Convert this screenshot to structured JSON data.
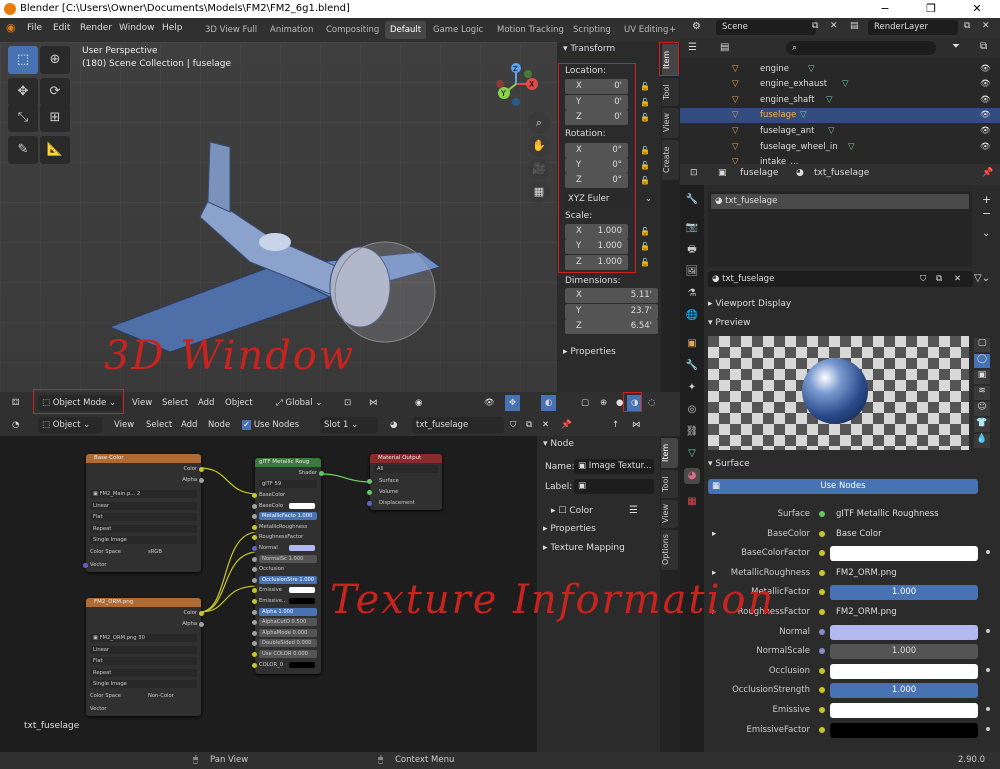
{
  "window": {
    "title": "Blender [C:\\Users\\Owner\\Documents\\Models\\FM2\\FM2_6g1.blend]",
    "minimize": "−",
    "maximize": "❐",
    "close": "✕"
  },
  "menu": [
    "File",
    "Edit",
    "Render",
    "Window",
    "Help"
  ],
  "workspaces": [
    "3D View Full",
    "Animation",
    "Compositing",
    "Default",
    "Game Logic",
    "Motion Tracking",
    "Scripting",
    "UV Editing"
  ],
  "workspace_add": "+",
  "active_workspace": "Default",
  "scene": {
    "label": "Scene",
    "render_layer": "RenderLayer"
  },
  "viewport": {
    "perspective": "User Perspective",
    "collection": "(180) Scene Collection | fuselage",
    "annotation": "3D Window"
  },
  "gizmo": {
    "x": "X",
    "y": "Y",
    "z": "Z"
  },
  "transform": {
    "header": "Transform",
    "location_label": "Location:",
    "location": [
      {
        "axis": "X",
        "value": "0'"
      },
      {
        "axis": "Y",
        "value": "0'"
      },
      {
        "axis": "Z",
        "value": "0'"
      }
    ],
    "rotation_label": "Rotation:",
    "rotation": [
      {
        "axis": "X",
        "value": "0°"
      },
      {
        "axis": "Y",
        "value": "0°"
      },
      {
        "axis": "Z",
        "value": "0°"
      }
    ],
    "rotation_mode": "XYZ Euler",
    "scale_label": "Scale:",
    "scale": [
      {
        "axis": "X",
        "value": "1.000"
      },
      {
        "axis": "Y",
        "value": "1.000"
      },
      {
        "axis": "Z",
        "value": "1.000"
      }
    ],
    "dimensions_label": "Dimensions:",
    "dimensions": [
      {
        "axis": "X",
        "value": "5.11'"
      },
      {
        "axis": "Y",
        "value": "23.7'"
      },
      {
        "axis": "Z",
        "value": "6.54'"
      }
    ],
    "properties": "Properties"
  },
  "n_tabs": [
    "Item",
    "Tool",
    "View",
    "Create"
  ],
  "viewport_header": {
    "mode": "Object Mode",
    "view": "View",
    "select": "Select",
    "add": "Add",
    "object": "Object",
    "orientation": "Global"
  },
  "node_header": {
    "type": "Object",
    "view": "View",
    "select": "Select",
    "add": "Add",
    "node": "Node",
    "use_nodes": "Use Nodes",
    "slot": "Slot 1",
    "material": "txt_fuselage"
  },
  "nodes": {
    "base_color": {
      "title": "Base Color",
      "out_color": "Color",
      "out_alpha": "Alpha",
      "image": "FM2_Main.p...",
      "users": "2",
      "interp": "Linear",
      "proj": "Flat",
      "ext": "Repeat",
      "source": "Single Image",
      "cs_label": "Color Space",
      "cs": "sRGB",
      "vector": "Vector"
    },
    "orm": {
      "title": "FM2_ORM.png",
      "out_color": "Color",
      "out_alpha": "Alpha",
      "image": "FM2_ORM.png",
      "users": "30",
      "interp": "Linear",
      "proj": "Flat",
      "ext": "Repeat",
      "source": "Single Image",
      "cs_label": "Color Space",
      "cs": "Non-Color",
      "vector": "Vector"
    },
    "gltf": {
      "title": "glTF Metallic Roug",
      "shader": "Shader",
      "group": "glTF",
      "users": "59",
      "rows": [
        "BaseColor",
        "BaseColo",
        "MetallicFacto 1.000",
        "MetallicRoughness",
        "RoughnessFactor",
        "Normal",
        "NormalSc 1.000",
        "Occlusion",
        "OcclusionStre 1.000",
        "Emissive",
        "Emissive...",
        "Alpha 1.000",
        "AlphaCutO 0.500",
        "AlphaMode 0.000",
        "DoubleSided 0.000",
        "Use COLOR 0.000",
        "COLOR_0"
      ]
    },
    "output": {
      "title": "Material Output",
      "target": "All",
      "surface": "Surface",
      "volume": "Volume",
      "displacement": "Displacement"
    },
    "frame_label": "txt_fuselage"
  },
  "node_side": {
    "header": "Node",
    "name_label": "Name:",
    "name": "Image Textur...",
    "label_label": "Label:",
    "color": "Color",
    "properties": "Properties",
    "texture_mapping": "Texture Mapping"
  },
  "node_tabs": [
    "Item",
    "Tool",
    "View",
    "Options"
  ],
  "annotation_texture": "Texture Information",
  "outliner": [
    {
      "name": "engine"
    },
    {
      "name": "engine_exhaust"
    },
    {
      "name": "engine_shaft"
    },
    {
      "name": "fuselage",
      "selected": true
    },
    {
      "name": "fuselage_ant"
    },
    {
      "name": "fuselage_wheel_in"
    },
    {
      "name": "intake_..."
    }
  ],
  "props": {
    "object": "fuselage",
    "material": "txt_fuselage",
    "slot": "txt_fuselage",
    "mat_field": "txt_fuselage",
    "viewport_display": "Viewport Display",
    "preview": "Preview",
    "surface": "Surface",
    "use_nodes": "Use Nodes",
    "rows": [
      {
        "label": "Surface",
        "value": "gITF Metallic Roughness",
        "kind": "link"
      },
      {
        "label": "BaseColor",
        "value": "Base Color",
        "kind": "link",
        "expand": true
      },
      {
        "label": "BaseColorFactor",
        "value": "",
        "kind": "white"
      },
      {
        "label": "MetallicRoughness",
        "value": "FM2_ORM.png",
        "kind": "link",
        "expand": true
      },
      {
        "label": "MetallicFactor",
        "value": "1.000",
        "kind": "blue"
      },
      {
        "label": "RoughnessFactor",
        "value": "FM2_ORM.png",
        "kind": "link",
        "expand": true
      },
      {
        "label": "Normal",
        "value": "",
        "kind": "lavender"
      },
      {
        "label": "NormalScale",
        "value": "1.000",
        "kind": "gray"
      },
      {
        "label": "Occlusion",
        "value": "",
        "kind": "white"
      },
      {
        "label": "OcclusionStrength",
        "value": "1.000",
        "kind": "blue"
      },
      {
        "label": "Emissive",
        "value": "",
        "kind": "white"
      },
      {
        "label": "EmissiveFactor",
        "value": "",
        "kind": "black"
      }
    ]
  },
  "status": {
    "pan": "Pan View",
    "context": "Context Menu",
    "version": "2.90.0"
  }
}
